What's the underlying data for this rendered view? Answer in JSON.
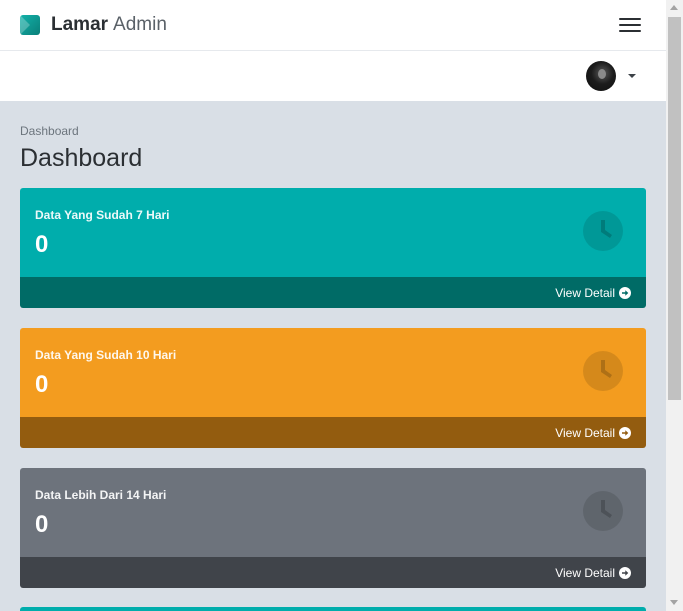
{
  "brand": {
    "name_bold": "Lamar",
    "name_light": "Admin",
    "logo_icon": "brand-logo-icon",
    "accent_color": "#13b1a9"
  },
  "header": {
    "menu_icon": "hamburger-menu-icon",
    "user_icon": "avatar",
    "dropdown_icon": "caret-down-icon"
  },
  "breadcrumb": {
    "current": "Dashboard"
  },
  "page": {
    "title": "Dashboard"
  },
  "cards": [
    {
      "label": "Data Yang Sudah 7 Hari",
      "value": "0",
      "footer": "View Detail",
      "icon": "clock-icon",
      "color": "#00adac",
      "footer_color": "#006b66"
    },
    {
      "label": "Data Yang Sudah 10 Hari",
      "value": "0",
      "footer": "View Detail",
      "icon": "clock-icon",
      "color": "#f39c1f",
      "footer_color": "#935c0f"
    },
    {
      "label": "Data Lebih Dari 14 Hari",
      "value": "0",
      "footer": "View Detail",
      "icon": "clock-icon",
      "color": "#6d737c",
      "footer_color": "#40444a"
    }
  ],
  "footer_arrow_icon": "arrow-circle-right-icon"
}
